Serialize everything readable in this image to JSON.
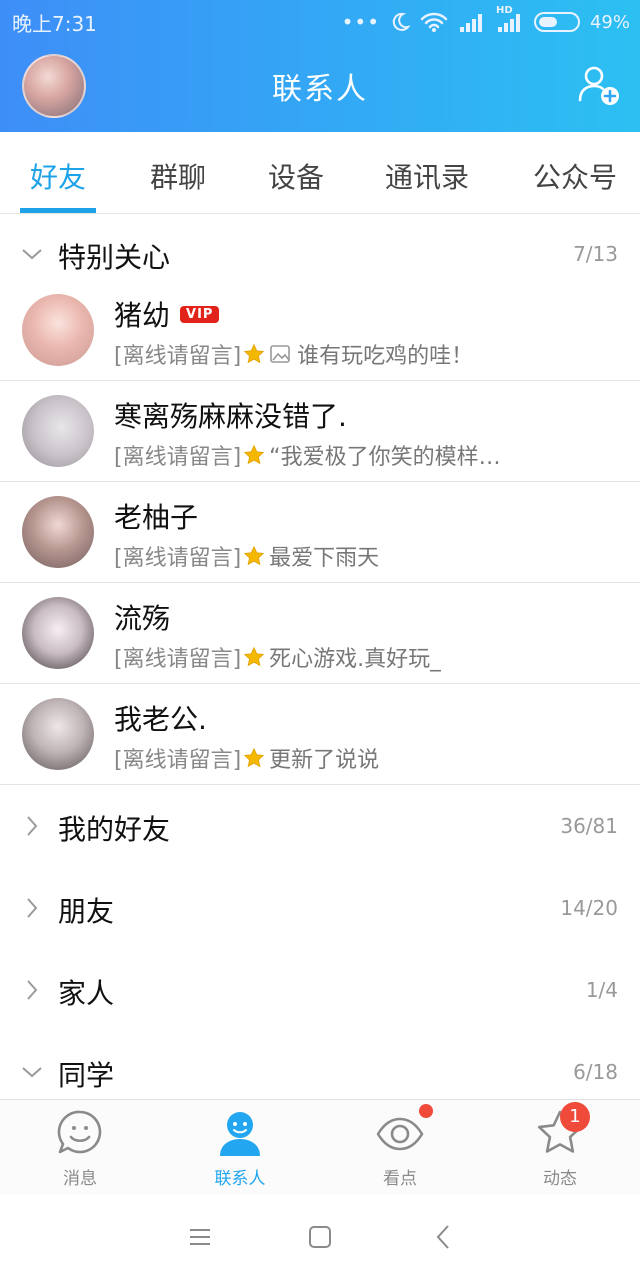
{
  "status_bar": {
    "time": "晚上7:31",
    "signal_label": "HD",
    "battery": "49%"
  },
  "header": {
    "title": "联系人"
  },
  "tabs": [
    {
      "label": "好友",
      "active": true
    },
    {
      "label": "群聊",
      "active": false
    },
    {
      "label": "设备",
      "active": false
    },
    {
      "label": "通讯录",
      "active": false
    },
    {
      "label": "公众号",
      "active": false
    }
  ],
  "groups": [
    {
      "name": "特别关心",
      "count": "7/13",
      "expanded": true
    },
    {
      "name": "我的好友",
      "count": "36/81",
      "expanded": false
    },
    {
      "name": "朋友",
      "count": "14/20",
      "expanded": false
    },
    {
      "name": "家人",
      "count": "1/4",
      "expanded": false
    },
    {
      "name": "同学",
      "count": "6/18",
      "expanded": true
    }
  ],
  "contacts": [
    {
      "name": "猪幼",
      "vip": "VIP",
      "status": "[离线请留言]",
      "message": "谁有玩吃鸡的哇！",
      "has_image_icon": true
    },
    {
      "name": "寒离殇麻麻没错了.",
      "status": "[离线请留言]",
      "message": "“我爱极了你笑的模样…"
    },
    {
      "name": "老柚子",
      "status": "[离线请留言]",
      "message": "最爱下雨天"
    },
    {
      "name": "流殇",
      "status": "[离线请留言]",
      "message": "死心游戏.真好玩_"
    },
    {
      "name": "我老公.",
      "status": "[离线请留言]",
      "message": "更新了说说"
    }
  ],
  "bottom_nav": [
    {
      "label": "消息",
      "icon": "smile-chat-icon"
    },
    {
      "label": "联系人",
      "icon": "person-icon",
      "active": true
    },
    {
      "label": "看点",
      "icon": "eye-icon"
    },
    {
      "label": "动态",
      "icon": "star-icon",
      "badge": "1"
    }
  ],
  "colors": {
    "accent": "#1fa3e8",
    "header_start": "#3e8ef7",
    "header_end": "#2cc0f2",
    "badge": "#f04a3a",
    "vip": "#e2231a",
    "star": "#f5b800"
  }
}
